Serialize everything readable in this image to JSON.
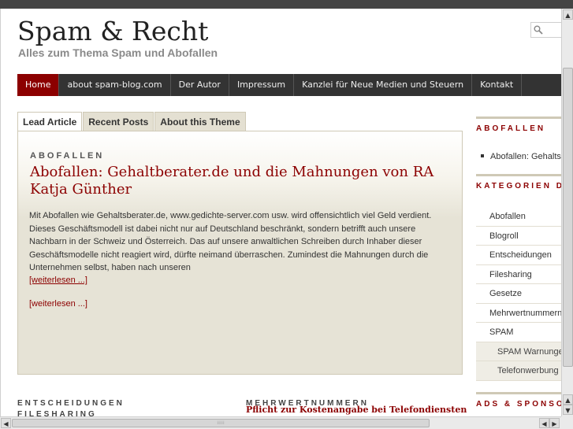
{
  "header": {
    "title": "Spam & Recht",
    "description": "Alles zum Thema Spam und Abofallen"
  },
  "nav": {
    "items": [
      "Home",
      "about spam-blog.com",
      "Der Autor",
      "Impressum",
      "Kanzlei für Neue Medien und Steuern",
      "Kontakt"
    ],
    "active_index": 0
  },
  "tabs": {
    "items": [
      "Lead Article",
      "Recent Posts",
      "About this Theme"
    ],
    "active_index": 0
  },
  "lead_article": {
    "category": "ABOFALLEN",
    "title": "Abofallen: Gehaltberater.de und die Mahnungen von RA Katja Günther",
    "body": "Mit Abofallen wie Gehaltsberater.de, www.gedichte-server.com usw. wird offensichtlich viel Geld verdient. Dieses Geschäftsmodell ist dabei nicht nur auf Deutschland beschränkt, sondern betrifft auch unsere Nachbarn in der Schweiz und Österreich. Das auf unsere anwaltlichen Schreiben durch Inhaber dieser Geschäftsmodelle nicht reagiert wird, dürfte neimand überraschen. Zumindest die Mahnungen durch die Unternehmen selbst, haben nach unseren",
    "read_more_1": "[weiterlesen ...]",
    "read_more_2": "[weiterlesen ...]"
  },
  "bottom": {
    "left_heading_1": "ENTSCHEIDUNGEN",
    "left_heading_2": "FILESHARING",
    "right_heading": "MEHRWERTNUMMERN",
    "right_link": "Pflicht zur Kostenangabe bei Telefondiensten"
  },
  "sidebar": {
    "abofallen_heading": "ABOFALLEN",
    "abofallen_item": "Abofallen: Gehaltsberater.de",
    "categories_heading": "KATEGORIEN DES BLOGS",
    "categories": [
      {
        "label": "Abofallen",
        "sub": false
      },
      {
        "label": "Blogroll",
        "sub": false
      },
      {
        "label": "Entscheidungen",
        "sub": false
      },
      {
        "label": "Filesharing",
        "sub": false
      },
      {
        "label": "Gesetze",
        "sub": false
      },
      {
        "label": "Mehrwertnummern",
        "sub": false
      },
      {
        "label": "SPAM",
        "sub": false
      },
      {
        "label": "SPAM Warnungen",
        "sub": true
      },
      {
        "label": "Telefonwerbung",
        "sub": true
      }
    ],
    "ads_heading": "ADS & SPONSORS"
  },
  "icons": {
    "search": "search-icon",
    "scroll_up": "arrow-up-icon",
    "scroll_down": "arrow-down-icon",
    "scroll_left": "arrow-left-icon",
    "scroll_right": "arrow-right-icon"
  },
  "colors": {
    "accent": "#8c0000",
    "nav_bg": "#333333",
    "panel_bg": "#e6e3d6"
  }
}
